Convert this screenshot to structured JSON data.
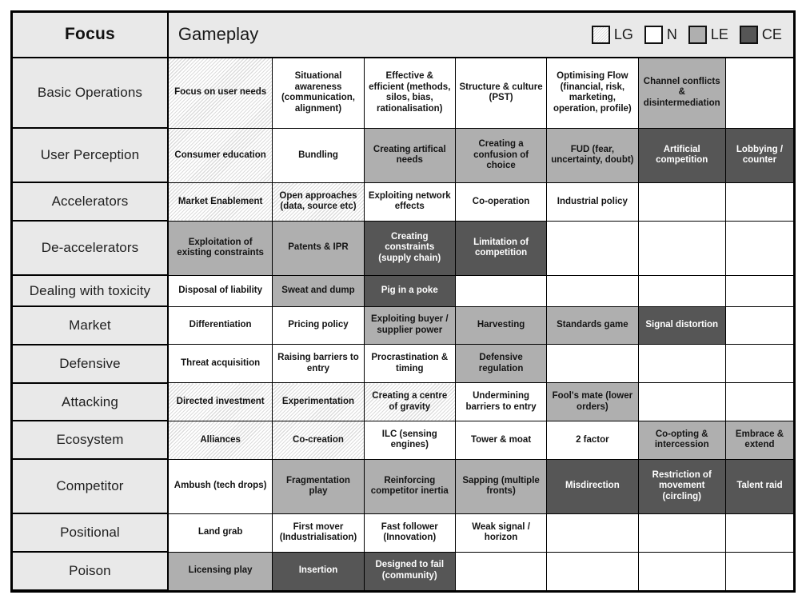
{
  "header": {
    "focus_label": "Focus",
    "gameplay_label": "Gameplay",
    "legend": [
      {
        "code": "LG",
        "label": "LG",
        "swatch": "hatched-swatch",
        "color": "#ffffff"
      },
      {
        "code": "N",
        "label": "N",
        "swatch": "white-swatch",
        "color": "#ffffff"
      },
      {
        "code": "LE",
        "label": "LE",
        "swatch": "light-gray-swatch",
        "color": "#afafaf"
      },
      {
        "code": "CE",
        "label": "CE",
        "swatch": "dark-gray-swatch",
        "color": "#565656"
      }
    ]
  },
  "colors": {
    "header_bg": "#e9e9e9",
    "row_header_bg": "#e9e9e9",
    "fill_N": "#ffffff",
    "fill_LE": "#afafaf",
    "fill_CE": "#565656",
    "hatch_line": "#dcdcdc",
    "border": "#000000"
  },
  "columns": 7,
  "rows": [
    {
      "focus": "Basic Operations",
      "cells": [
        {
          "text": "Focus on user needs",
          "fill": "LG"
        },
        {
          "text": "Situational awareness (communication, alignment)",
          "fill": "N"
        },
        {
          "text": "Effective & efficient (methods, silos, bias, rationalisation)",
          "fill": "N"
        },
        {
          "text": "Structure & culture (PST)",
          "fill": "N"
        },
        {
          "text": "Optimising Flow (financial, risk, marketing, operation, profile)",
          "fill": "N"
        },
        {
          "text": "Channel conflicts & disintermediation",
          "fill": "LE"
        },
        {
          "text": "",
          "fill": "N"
        }
      ]
    },
    {
      "focus": "User Perception",
      "cells": [
        {
          "text": "Consumer education",
          "fill": "LG"
        },
        {
          "text": "Bundling",
          "fill": "N"
        },
        {
          "text": "Creating artifical needs",
          "fill": "LE"
        },
        {
          "text": "Creating a confusion of choice",
          "fill": "LE"
        },
        {
          "text": "FUD (fear, uncertainty, doubt)",
          "fill": "LE"
        },
        {
          "text": "Artificial competition",
          "fill": "CE"
        },
        {
          "text": "Lobbying / counter",
          "fill": "CE"
        }
      ]
    },
    {
      "focus": "Accelerators",
      "cells": [
        {
          "text": "Market Enablement",
          "fill": "LG"
        },
        {
          "text": "Open approaches (data, source etc)",
          "fill": "LG"
        },
        {
          "text": "Exploiting network effects",
          "fill": "N"
        },
        {
          "text": "Co-operation",
          "fill": "N"
        },
        {
          "text": "Industrial policy",
          "fill": "N"
        },
        {
          "text": "",
          "fill": "N"
        },
        {
          "text": "",
          "fill": "N"
        }
      ]
    },
    {
      "focus": "De-accelerators",
      "cells": [
        {
          "text": "Exploitation of existing constraints",
          "fill": "LE"
        },
        {
          "text": "Patents & IPR",
          "fill": "LE"
        },
        {
          "text": "Creating constraints (supply chain)",
          "fill": "CE"
        },
        {
          "text": "Limitation of competition",
          "fill": "CE"
        },
        {
          "text": "",
          "fill": "N"
        },
        {
          "text": "",
          "fill": "N"
        },
        {
          "text": "",
          "fill": "N"
        }
      ]
    },
    {
      "focus": "Dealing with toxicity",
      "cells": [
        {
          "text": "Disposal of liability",
          "fill": "N"
        },
        {
          "text": "Sweat and dump",
          "fill": "LE"
        },
        {
          "text": "Pig in a poke",
          "fill": "CE"
        },
        {
          "text": "",
          "fill": "N"
        },
        {
          "text": "",
          "fill": "N"
        },
        {
          "text": "",
          "fill": "N"
        },
        {
          "text": "",
          "fill": "N"
        }
      ]
    },
    {
      "focus": "Market",
      "cells": [
        {
          "text": "Differentiation",
          "fill": "N"
        },
        {
          "text": "Pricing policy",
          "fill": "N"
        },
        {
          "text": "Exploiting buyer / supplier power",
          "fill": "LE"
        },
        {
          "text": "Harvesting",
          "fill": "LE"
        },
        {
          "text": "Standards game",
          "fill": "LE"
        },
        {
          "text": "Signal distortion",
          "fill": "CE"
        },
        {
          "text": "",
          "fill": "N"
        }
      ]
    },
    {
      "focus": "Defensive",
      "cells": [
        {
          "text": "Threat acquisition",
          "fill": "N"
        },
        {
          "text": "Raising barriers to entry",
          "fill": "N"
        },
        {
          "text": "Procrastination & timing",
          "fill": "N"
        },
        {
          "text": "Defensive regulation",
          "fill": "LE"
        },
        {
          "text": "",
          "fill": "N"
        },
        {
          "text": "",
          "fill": "N"
        },
        {
          "text": "",
          "fill": "N"
        }
      ]
    },
    {
      "focus": "Attacking",
      "cells": [
        {
          "text": "Directed investment",
          "fill": "LG"
        },
        {
          "text": "Experimentation",
          "fill": "LG"
        },
        {
          "text": "Creating a centre of gravity",
          "fill": "LG"
        },
        {
          "text": "Undermining barriers to entry",
          "fill": "N"
        },
        {
          "text": "Fool's mate (lower orders)",
          "fill": "LE"
        },
        {
          "text": "",
          "fill": "N"
        },
        {
          "text": "",
          "fill": "N"
        }
      ]
    },
    {
      "focus": "Ecosystem",
      "cells": [
        {
          "text": "Alliances",
          "fill": "LG"
        },
        {
          "text": "Co-creation",
          "fill": "LG"
        },
        {
          "text": "ILC (sensing engines)",
          "fill": "N"
        },
        {
          "text": "Tower & moat",
          "fill": "N"
        },
        {
          "text": "2 factor",
          "fill": "N"
        },
        {
          "text": "Co-opting & intercession",
          "fill": "LE"
        },
        {
          "text": "Embrace & extend",
          "fill": "LE"
        }
      ]
    },
    {
      "focus": "Competitor",
      "cells": [
        {
          "text": "Ambush (tech drops)",
          "fill": "N"
        },
        {
          "text": "Fragmentation play",
          "fill": "LE"
        },
        {
          "text": "Reinforcing competitor inertia",
          "fill": "LE"
        },
        {
          "text": "Sapping (multiple fronts)",
          "fill": "LE"
        },
        {
          "text": "Misdirection",
          "fill": "CE"
        },
        {
          "text": "Restriction of movement (circling)",
          "fill": "CE"
        },
        {
          "text": "Talent raid",
          "fill": "CE"
        }
      ]
    },
    {
      "focus": "Positional",
      "cells": [
        {
          "text": "Land grab",
          "fill": "N"
        },
        {
          "text": "First mover (Industrialisation)",
          "fill": "N"
        },
        {
          "text": "Fast follower (Innovation)",
          "fill": "N"
        },
        {
          "text": "Weak signal / horizon",
          "fill": "N"
        },
        {
          "text": "",
          "fill": "N"
        },
        {
          "text": "",
          "fill": "N"
        },
        {
          "text": "",
          "fill": "N"
        }
      ]
    },
    {
      "focus": "Poison",
      "cells": [
        {
          "text": "Licensing play",
          "fill": "LE"
        },
        {
          "text": "Insertion",
          "fill": "CE"
        },
        {
          "text": "Designed to fail (community)",
          "fill": "CE"
        },
        {
          "text": "",
          "fill": "N"
        },
        {
          "text": "",
          "fill": "N"
        },
        {
          "text": "",
          "fill": "N"
        },
        {
          "text": "",
          "fill": "N"
        }
      ]
    }
  ]
}
